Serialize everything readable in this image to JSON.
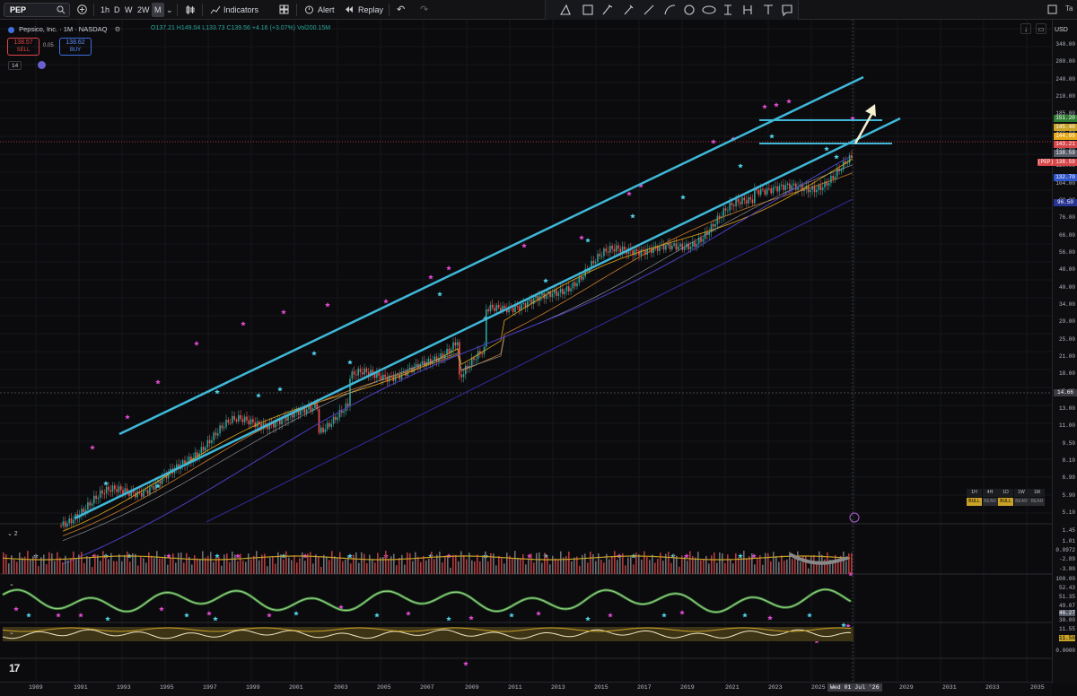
{
  "toolbar": {
    "symbol": "PEP",
    "timeframes": [
      "1h",
      "D",
      "W",
      "2W",
      "M"
    ],
    "active_timeframe": "M",
    "indicators_label": "Indicators",
    "alert_label": "Alert",
    "replay_label": "Replay"
  },
  "drawing_tools": [
    "trend-line-tool",
    "rectangle-tool",
    "brush-tool",
    "pen-tool",
    "line-tool",
    "curve-tool",
    "circle-tool",
    "ellipse-tool",
    "vertical-range-tool",
    "fork-tool",
    "text-tool",
    "note-tool"
  ],
  "legend": {
    "title": "Pepsico, Inc. · 1M · NASDAQ",
    "ohlc": "O137.21 H149.04 L133.73 C139.56 +4.16 (+3.07%) Vol200.15M",
    "sell_price": "138.57",
    "sell_label": "SELL",
    "spread": "0.05",
    "buy_price": "138.62",
    "buy_label": "BUY",
    "indicator_count": "14"
  },
  "price_axis": {
    "currency": "USD",
    "labels": [
      "340.00",
      "280.00",
      "240.00",
      "210.00",
      "185.00",
      "160.00",
      "140.00",
      "120.00",
      "104.00",
      "88.00",
      "76.00",
      "66.00",
      "56.00",
      "48.00",
      "40.00",
      "34.00",
      "29.00",
      "25.00",
      "21.00",
      "18.00",
      "15.00",
      "13.00",
      "11.00",
      "9.50",
      "8.10",
      "6.90",
      "5.90",
      "5.10"
    ],
    "tags": [
      {
        "text": "151.20",
        "color": "#2e7d32"
      },
      {
        "text": "145.40",
        "color": "#c9a227"
      },
      {
        "text": "144.99",
        "color": "#e6a817"
      },
      {
        "text": "143.21",
        "color": "#d7474a"
      },
      {
        "text": "138.59",
        "color": "#555a66"
      },
      {
        "text": "138.59",
        "color": "#d7474a"
      },
      {
        "text": "(PEP)",
        "color": "#d7474a"
      },
      {
        "text": "132.70",
        "color": "#2f56c9"
      },
      {
        "text": "96.50",
        "color": "#283593"
      }
    ],
    "crosshair_price": "14.66"
  },
  "time_axis": {
    "labels": [
      "1989",
      "1991",
      "1993",
      "1995",
      "1997",
      "1999",
      "2001",
      "2003",
      "2005",
      "2007",
      "2009",
      "2011",
      "2013",
      "2015",
      "2017",
      "2019",
      "2021",
      "2023",
      "2025",
      "2029",
      "2031",
      "2033",
      "2035"
    ],
    "crosshair_date": "Wed 01 Jul '26"
  },
  "panes": [
    {
      "id": "pane-2",
      "label": "2",
      "values": [
        "1.45",
        "1.01",
        "0.0972",
        "-2.89",
        "-3.80"
      ]
    },
    {
      "id": "pane-3",
      "values": [
        "100.00",
        "52.43",
        "51.35",
        "49.07",
        "46.27"
      ]
    },
    {
      "id": "pane-4",
      "values": [
        "30.00",
        "11.55",
        "11.56",
        "0.0000"
      ]
    }
  ],
  "mini_table": {
    "headers": [
      "1H",
      "4H",
      "1D",
      "1W",
      "1M"
    ],
    "values": [
      "BULL",
      "BEAR",
      "BULL",
      "BEAR",
      "BEAR"
    ]
  },
  "colors": {
    "channel": "#3fb8d8",
    "up_candle": "#26a69a",
    "down_candle": "#ef5350",
    "star_pink": "#e04ad1",
    "star_cyan": "#4fd0e8"
  }
}
